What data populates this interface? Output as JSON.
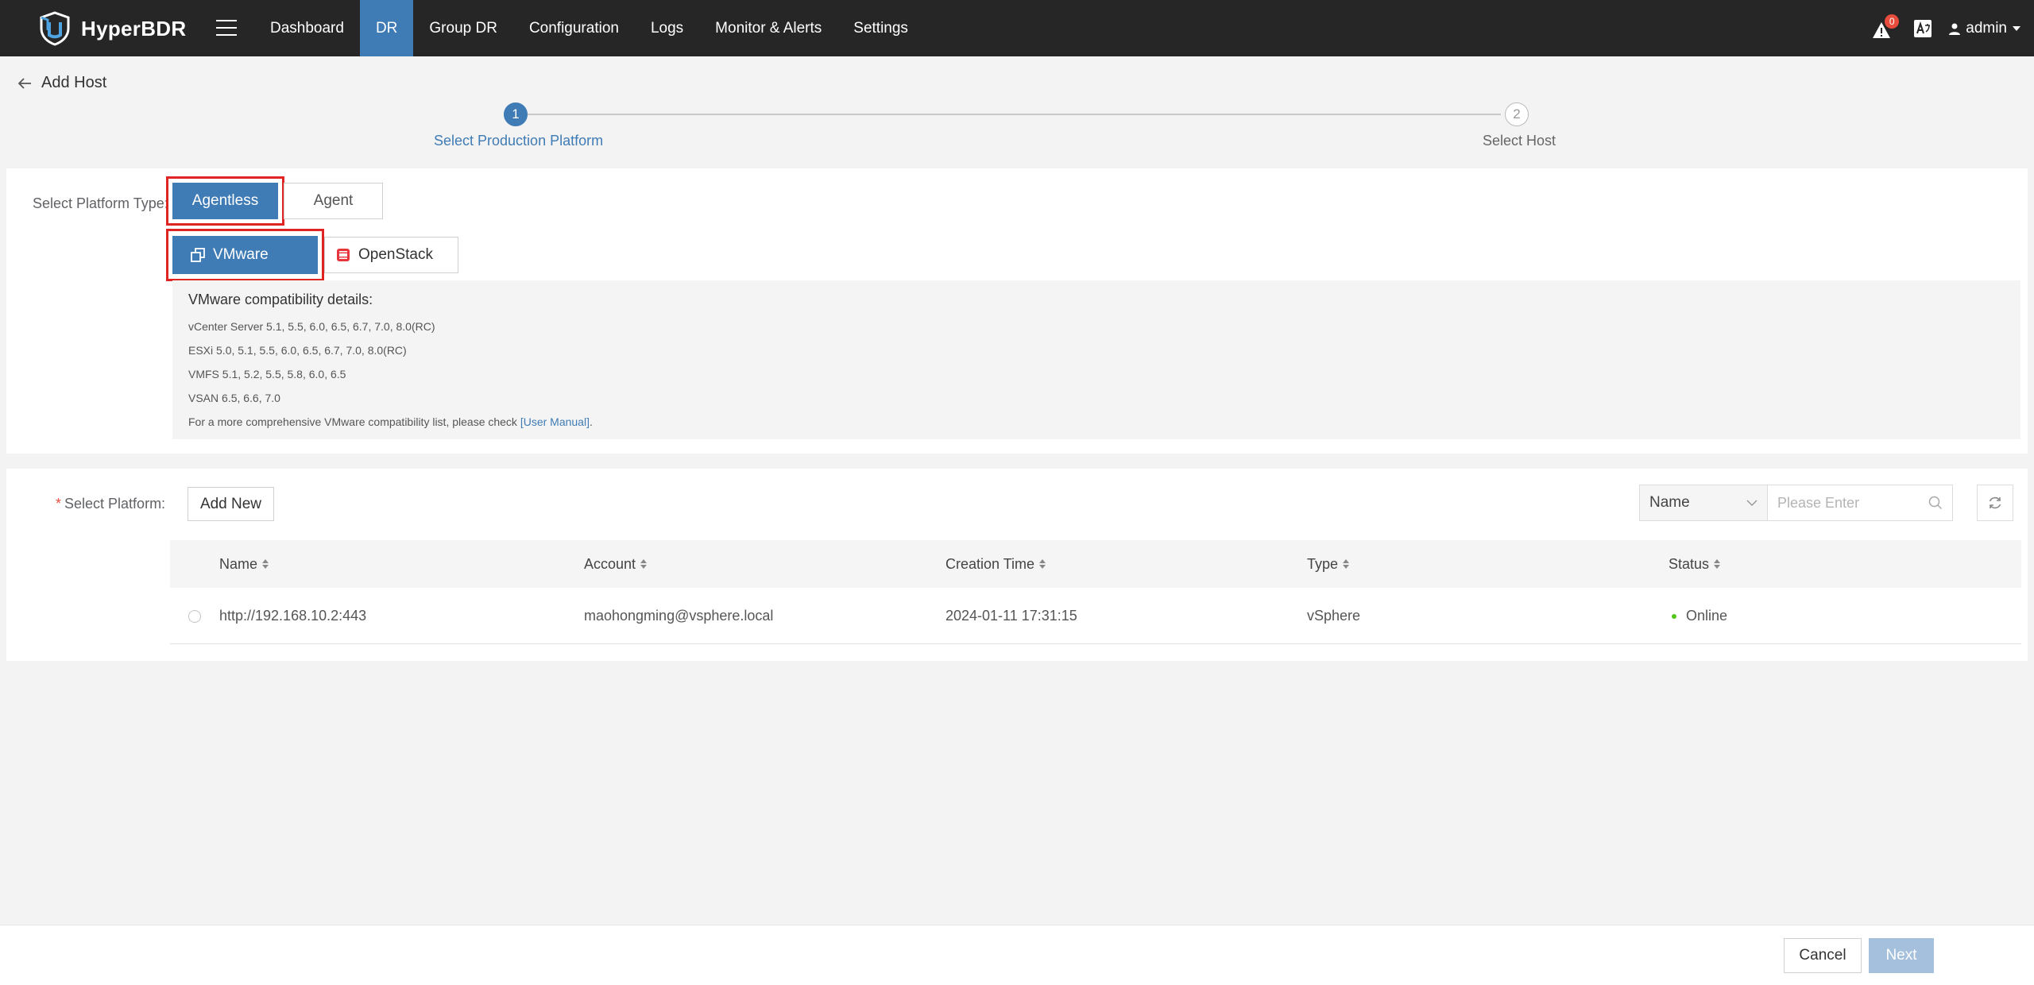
{
  "app": {
    "name": "HyperBDR"
  },
  "nav": {
    "items": [
      {
        "label": "Dashboard"
      },
      {
        "label": "DR"
      },
      {
        "label": "Group DR"
      },
      {
        "label": "Configuration"
      },
      {
        "label": "Logs"
      },
      {
        "label": "Monitor & Alerts"
      },
      {
        "label": "Settings"
      }
    ],
    "active_label": "DR"
  },
  "topbar": {
    "alert_count": "0",
    "user": "admin"
  },
  "page": {
    "title": "Add Host"
  },
  "steps": [
    {
      "number": "1",
      "label": "Select Production Platform",
      "state": "active"
    },
    {
      "number": "2",
      "label": "Select Host",
      "state": "pending"
    }
  ],
  "platform_type": {
    "label": "Select Platform Type:",
    "options": [
      "Agentless",
      "Agent"
    ],
    "selected": "Agentless"
  },
  "platform": {
    "options": [
      "VMware",
      "OpenStack"
    ],
    "selected": "VMware"
  },
  "compatibility": {
    "title": "VMware compatibility details:",
    "lines": [
      "vCenter Server 5.1, 5.5, 6.0, 6.5, 6.7, 7.0, 8.0(RC)",
      "ESXi 5.0, 5.1, 5.5, 6.0, 6.5, 6.7, 7.0, 8.0(RC)",
      "VMFS 5.1, 5.2, 5.5, 5.8, 6.0, 6.5",
      "VSAN 6.5, 6.6, 7.0"
    ],
    "note_prefix": "For a more comprehensive VMware compatibility list, please check ",
    "note_link": "[User Manual]",
    "note_suffix": "."
  },
  "select_platform": {
    "label": "Select Platform:",
    "required_mark": "*",
    "add_new_label": "Add New",
    "search_field": "Name",
    "search_placeholder": "Please Enter"
  },
  "table": {
    "columns": [
      "Name",
      "Account",
      "Creation Time",
      "Type",
      "Status"
    ],
    "rows": [
      {
        "name": "http://192.168.10.2:443",
        "account": "maohongming@vsphere.local",
        "creation_time": "2024-01-11 17:31:15",
        "type": "vSphere",
        "status": "Online"
      }
    ]
  },
  "footer": {
    "cancel_label": "Cancel",
    "next_label": "Next"
  },
  "colors": {
    "topbar_bg": "#262626",
    "accent": "#3f7bb5",
    "highlight_border": "#e02424",
    "online": "#52c41a",
    "openstack_red": "#e8343b",
    "next_disabled": "#a4c0dc"
  }
}
